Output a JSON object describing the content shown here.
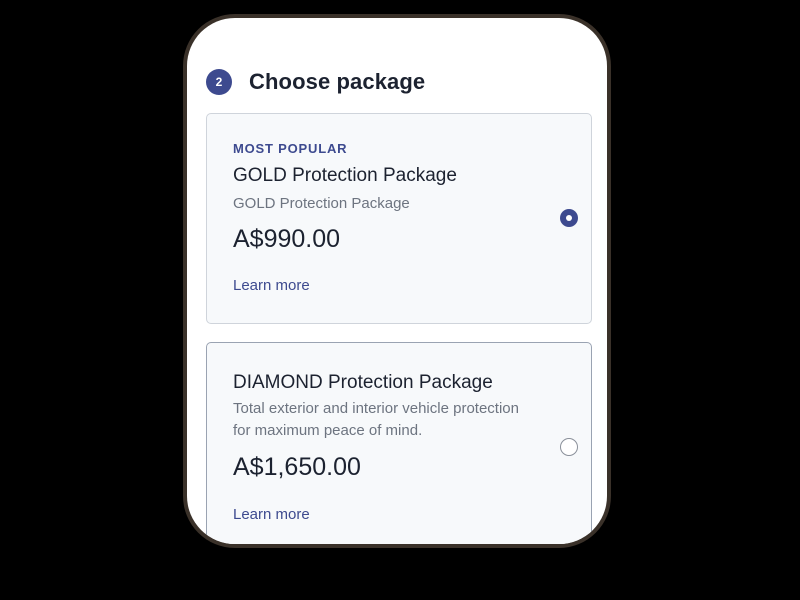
{
  "section": {
    "step_number": "2",
    "title": "Choose package"
  },
  "packages": [
    {
      "tag": "MOST POPULAR",
      "name": "GOLD Protection Package",
      "description": "GOLD Protection Package",
      "price": "A$990.00",
      "link_label": "Learn more",
      "selected": true
    },
    {
      "tag": "",
      "name": "DIAMOND Protection Package",
      "description": "Total exterior and interior vehicle protection for maximum peace of mind.",
      "price": "A$1,650.00",
      "link_label": "Learn more",
      "selected": false
    }
  ],
  "colors": {
    "accent": "#3d4a8f",
    "text_primary": "#1c2230",
    "text_secondary": "#6d7480",
    "card_background": "#f7f9fb",
    "device_frame": "#3a3129"
  }
}
